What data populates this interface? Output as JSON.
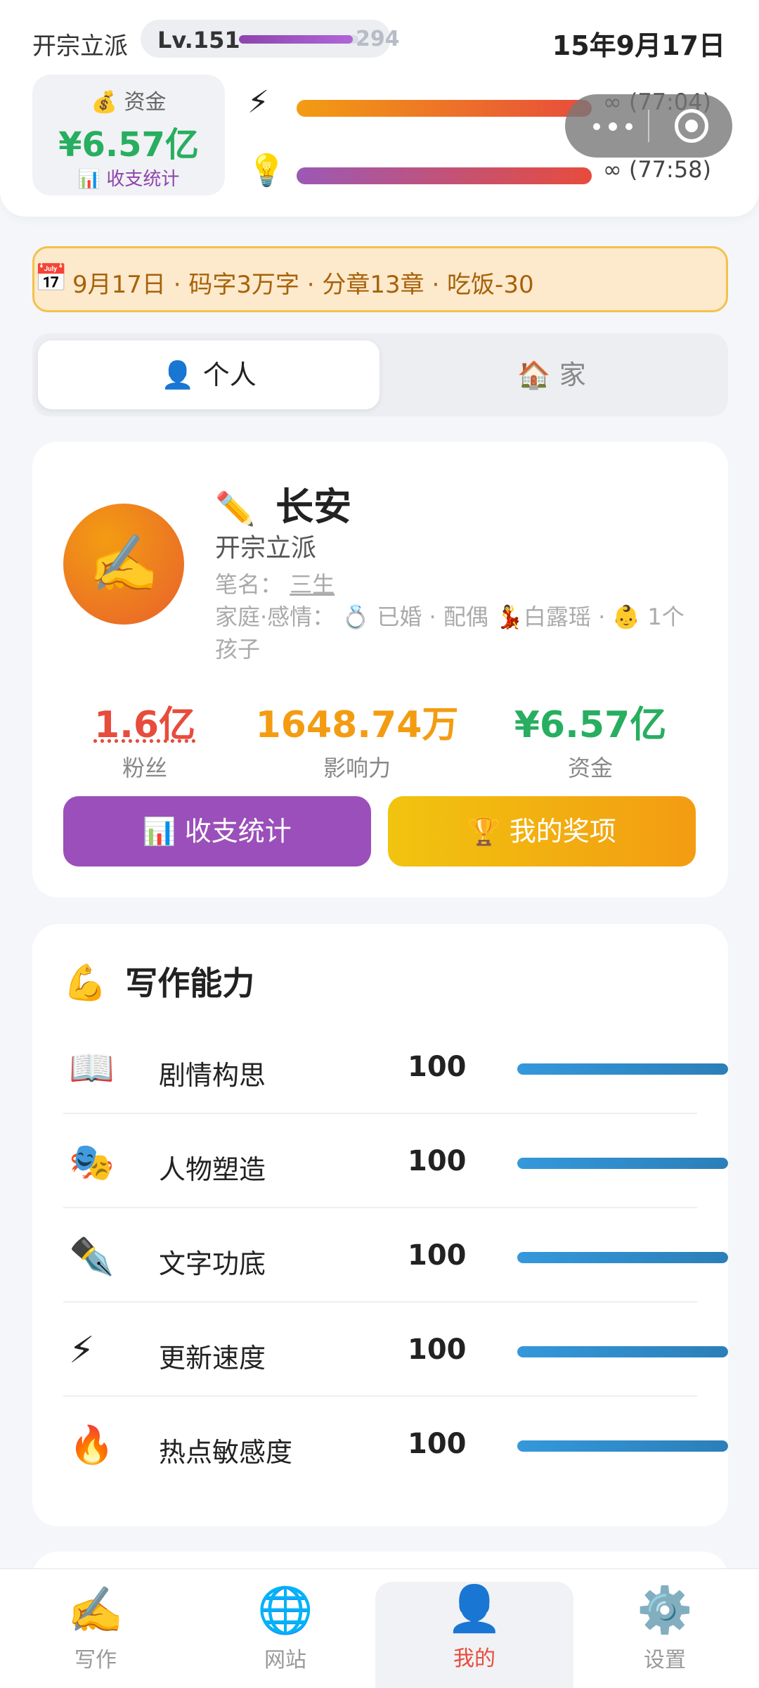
{
  "header": {
    "rank_title": "开宗立派",
    "level_label": "Lv.151",
    "level_max": "294",
    "date": "15年9月17日",
    "level_progress": 0.95
  },
  "funds": {
    "label_icon": "💰",
    "label": "资金",
    "value": "¥6.57亿",
    "link_icon": "📊",
    "link": "收支统计"
  },
  "meters": [
    {
      "icon": "⚡",
      "icon_name": "lightning-icon",
      "text": "∞ (77:04)"
    },
    {
      "icon": "💡",
      "icon_name": "lightbulb-icon",
      "text": "∞ (77:58)"
    }
  ],
  "notice": {
    "icon": "📅",
    "text": "9月17日 · 码字3万字 · 分章13章 · 吃饭-30"
  },
  "tabs": [
    {
      "icon": "👤",
      "label": "个人",
      "active": true
    },
    {
      "icon": "🏠",
      "label": "家",
      "active": false
    }
  ],
  "profile": {
    "avatar_icon": "✍️",
    "name_icon": "✏️",
    "name": "长安",
    "title": "开宗立派",
    "pen_name_label": "笔名：",
    "pen_name": "三生",
    "family_line1": "家庭·感情： 💍 已婚 · 配偶 💃白露瑶 · 👶 1个",
    "family_line2": "孩子",
    "stats": [
      {
        "value": "1.6亿",
        "label": "粉丝"
      },
      {
        "value": "1648.74万",
        "label": "影响力"
      },
      {
        "value": "¥6.57亿",
        "label": "资金"
      }
    ],
    "btn_stats": "📊 收支统计",
    "btn_awards": "🏆 我的奖项"
  },
  "abilities": {
    "title_icon": "💪",
    "title": "写作能力",
    "items": [
      {
        "icon": "📖",
        "name": "剧情构思",
        "value": "100",
        "level": 1.0
      },
      {
        "icon": "🎭",
        "name": "人物塑造",
        "value": "100",
        "level": 1.0
      },
      {
        "icon": "✒️",
        "name": "文字功底",
        "value": "100",
        "level": 1.0
      },
      {
        "icon": "⚡",
        "name": "更新速度",
        "value": "100",
        "level": 1.0
      },
      {
        "icon": "🔥",
        "name": "热点敏感度",
        "value": "100",
        "level": 1.0
      }
    ]
  },
  "nav": [
    {
      "icon": "✍️",
      "label": "写作"
    },
    {
      "icon": "🌐",
      "label": "网站"
    },
    {
      "icon": "👤",
      "label": "我的"
    },
    {
      "icon": "⚙️",
      "label": "设置"
    }
  ],
  "colors": {
    "funds_green": "#27ae60",
    "fans_red": "#e74c3c",
    "influence_orange": "#f39c12",
    "purple": "#9b4fba",
    "ability_blue": "#3498db"
  }
}
